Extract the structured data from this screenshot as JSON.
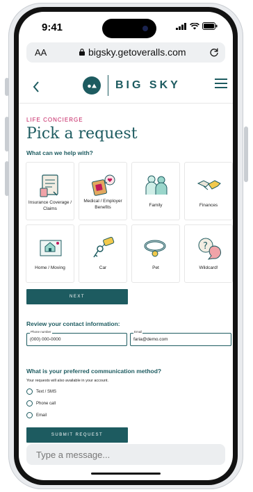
{
  "status_bar": {
    "time": "9:41"
  },
  "browser": {
    "aa_label": "AA",
    "url": "bigsky.getoveralls.com"
  },
  "header": {
    "brand": "BIG SKY"
  },
  "page": {
    "eyebrow": "LIFE CONCIERGE",
    "title": "Pick a request",
    "question": "What can we help with?",
    "categories": [
      {
        "label": "Insurance Coverage / Claims"
      },
      {
        "label": "Medical / Employer Benefits"
      },
      {
        "label": "Family"
      },
      {
        "label": "Finances"
      },
      {
        "label": "Home / Moving"
      },
      {
        "label": "Car"
      },
      {
        "label": "Pet"
      },
      {
        "label": "Wildcard!"
      }
    ],
    "next_label": "NEXT"
  },
  "contact": {
    "heading": "Review your contact information:",
    "phone_label": "Phone number",
    "phone_value": "(000) 000-0000",
    "email_label": "Email",
    "email_value": "faria@demo.com"
  },
  "communication": {
    "heading": "What is your preferred communication method?",
    "note": "Your requests will also available in your account.",
    "options": [
      {
        "label": "Text / SMS"
      },
      {
        "label": "Phone call"
      },
      {
        "label": "Email"
      }
    ],
    "submit_label": "SUBMIT REQUEST"
  },
  "message_bar": {
    "placeholder": "Type a message..."
  },
  "colors": {
    "brand": "#1d5b60",
    "accent": "#c2185b"
  }
}
